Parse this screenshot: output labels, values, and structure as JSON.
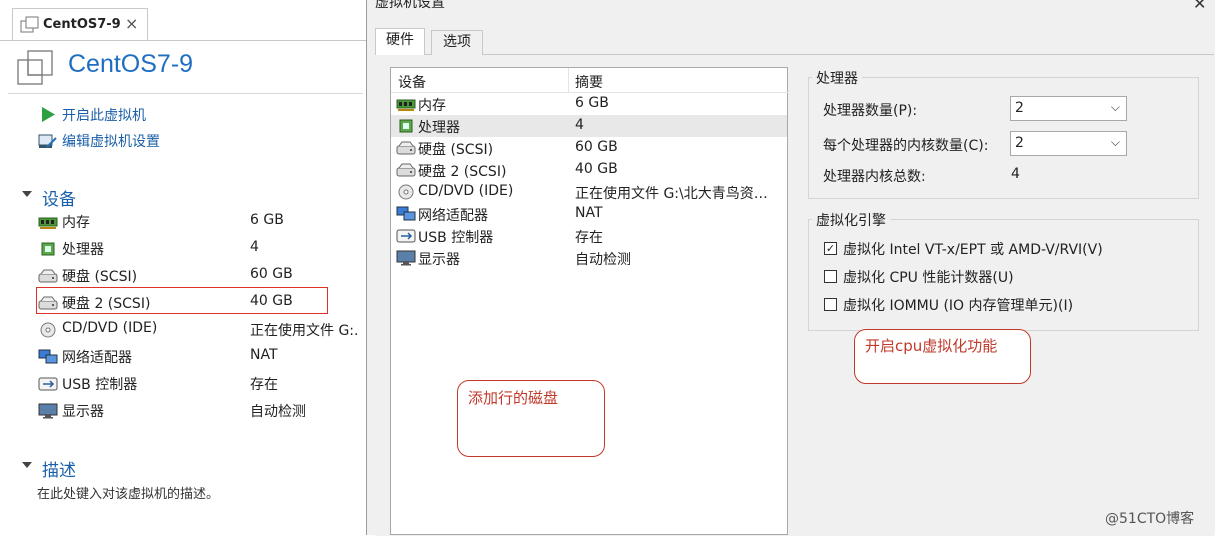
{
  "left": {
    "tab_title": "CentOS7-9",
    "tab_close": "×",
    "vm_title": "CentOS7-9",
    "actions": [
      {
        "label": "开启此虚拟机",
        "icon": "play-icon"
      },
      {
        "label": "编辑虚拟机设置",
        "icon": "edit-settings-icon"
      }
    ],
    "devices_heading": "设备",
    "devices": [
      {
        "name": "内存",
        "value": "6 GB",
        "icon": "memory-icon"
      },
      {
        "name": "处理器",
        "value": "4",
        "icon": "processor-icon"
      },
      {
        "name": "硬盘 (SCSI)",
        "value": "60 GB",
        "icon": "hard-disk-icon"
      },
      {
        "name": "硬盘 2 (SCSI)",
        "value": "40 GB",
        "icon": "hard-disk-icon"
      },
      {
        "name": "CD/DVD (IDE)",
        "value": "正在使用文件 G:.",
        "icon": "cd-dvd-icon"
      },
      {
        "name": "网络适配器",
        "value": "NAT",
        "icon": "network-adapter-icon"
      },
      {
        "name": "USB 控制器",
        "value": "存在",
        "icon": "usb-icon"
      },
      {
        "name": "显示器",
        "value": "自动检测",
        "icon": "display-icon"
      }
    ],
    "description_heading": "描述",
    "description_text": "在此处键入对该虚拟机的描述。"
  },
  "dialog": {
    "title": "虚拟机设置",
    "close": "✕",
    "tabs": [
      {
        "label": "硬件"
      },
      {
        "label": "选项"
      }
    ],
    "list_headers": {
      "device": "设备",
      "summary": "摘要"
    },
    "devices": [
      {
        "name": "内存",
        "value": "6 GB",
        "icon": "memory-icon"
      },
      {
        "name": "处理器",
        "value": "4",
        "icon": "processor-icon",
        "selected": true
      },
      {
        "name": "硬盘 (SCSI)",
        "value": "60 GB",
        "icon": "hard-disk-icon"
      },
      {
        "name": "硬盘 2 (SCSI)",
        "value": "40 GB",
        "icon": "hard-disk-icon"
      },
      {
        "name": "CD/DVD (IDE)",
        "value": "正在使用文件 G:\\北大青鸟资…",
        "icon": "cd-dvd-icon"
      },
      {
        "name": "网络适配器",
        "value": "NAT",
        "icon": "network-adapter-icon"
      },
      {
        "name": "USB 控制器",
        "value": "存在",
        "icon": "usb-icon"
      },
      {
        "name": "显示器",
        "value": "自动检测",
        "icon": "display-icon"
      }
    ],
    "processor": {
      "group_title": "处理器",
      "count_label": "处理器数量(P):",
      "count_value": "2",
      "cores_label": "每个处理器的内核数量(C):",
      "cores_value": "2",
      "total_label": "处理器内核总数:",
      "total_value": "4"
    },
    "virtualization": {
      "group_title": "虚拟化引擎",
      "options": [
        {
          "label": "虚拟化 Intel VT-x/EPT 或 AMD-V/RVI(V)",
          "checked": true
        },
        {
          "label": "虚拟化 CPU 性能计数器(U)",
          "checked": false
        },
        {
          "label": "虚拟化 IOMMU (IO 内存管理单元)(I)",
          "checked": false
        }
      ]
    }
  },
  "annotations": {
    "added_disk": "添加行的磁盘",
    "enable_cpu_virt": "开启cpu虚拟化功能"
  },
  "watermark": "@51CTO博客"
}
